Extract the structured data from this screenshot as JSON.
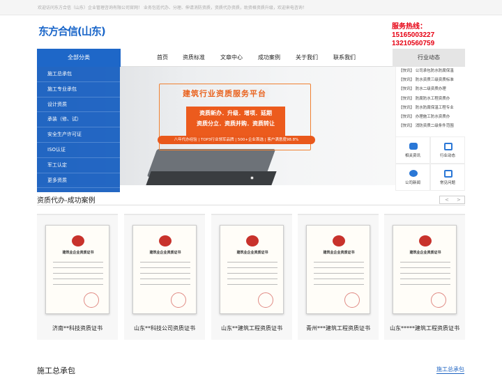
{
  "topbar": {
    "text": "欢迎访问东方合信（山东）企业管理咨询有限公司官网！ 业务包括代办、分理、伸请消防资质，资质代办资质，助资格资质升级，欢迎来电咨询！"
  },
  "logo": {
    "text": "东方合信(山东)"
  },
  "hotline": {
    "label": "服务热线：",
    "phone1": "15165003227",
    "phone2": "13210560759"
  },
  "nav": {
    "all_label": "全部分类",
    "items": [
      "首页",
      "资质标准",
      "文章中心",
      "成功案例",
      "关于我们",
      "联系我们"
    ],
    "trend_label": "行业动态"
  },
  "sidemenu": [
    "施工总承包",
    "施工专业承包",
    "设计资质",
    "承装（修、试）",
    "安全生产许可证",
    "ISO认证",
    "军工认定",
    "更多资质"
  ],
  "banner": {
    "title": "建筑行业资质服务平台",
    "line1": "资质新办．升级．增项．延期",
    "line2": "资质分立．资质并购．资质转让",
    "bar": "八年代办经验 | TOP3行业领军品牌 | 500+企业首选 | 客户满意度98.8%"
  },
  "news": [
    "【快讯】 公司承包防水防腐保温",
    "【快讯】 防水资质三级资质标准",
    "【快讯】 防水二级资质办理",
    "【快讯】 防腐防水工程资质办",
    "【快讯】 防水防腐保温工程专业",
    "【快讯】 办理施工防水资质办",
    "【快讯】 消防资质二级条件范围"
  ],
  "quick": [
    "相关资讯",
    "行业动态",
    "公司新闻",
    "常见问题"
  ],
  "cases": {
    "title": "资质代办-成功案例",
    "prev": "<",
    "next": ">",
    "cert_title": "建筑业企业资质证书",
    "items": [
      "济南**科技资质证书",
      "山东**科技公司资质证书",
      "山东**建筑工程资质证书",
      "青州***建筑工程资质证书",
      "山东*****建筑工程资质证书"
    ]
  },
  "section": {
    "title": "施工总承包",
    "more": "施工总承包"
  }
}
